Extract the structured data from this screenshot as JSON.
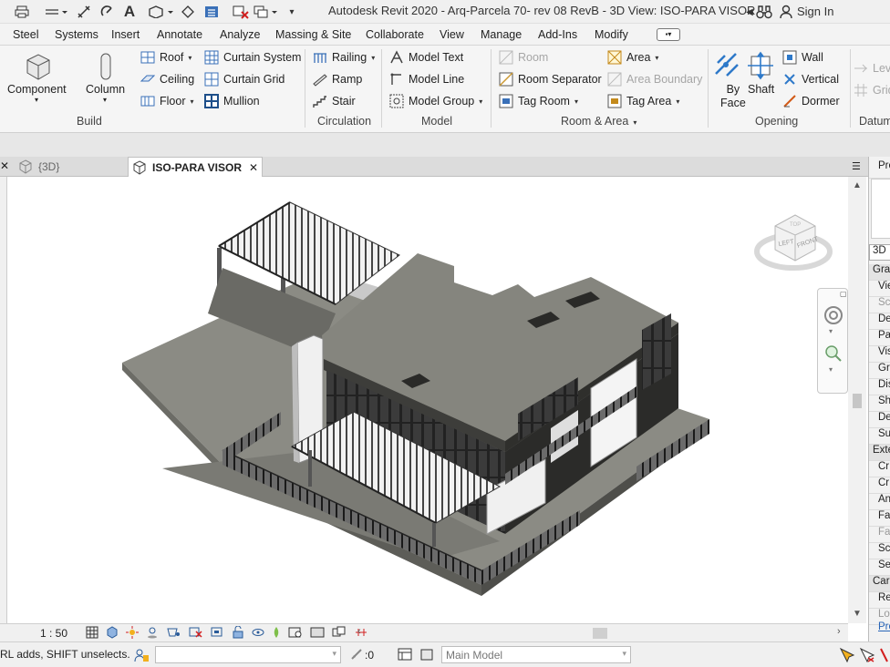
{
  "titlebar": {
    "title": "Autodesk Revit 2020 - Arq-Parcela 70- rev 08 RevB - 3D View: ISO-PARA VISOR",
    "sign_in": "Sign In"
  },
  "menu": {
    "tabs": [
      "Steel",
      "Systems",
      "Insert",
      "Annotate",
      "Analyze",
      "Massing & Site",
      "Collaborate",
      "View",
      "Manage",
      "Add-Ins",
      "Modify"
    ]
  },
  "ribbon": {
    "build": {
      "title": "Build",
      "component": "Component",
      "column": "Column",
      "roof": "Roof",
      "ceiling": "Ceiling",
      "floor": "Floor",
      "curtain_system": "Curtain System",
      "curtain_grid": "Curtain Grid",
      "mullion": "Mullion"
    },
    "circulation": {
      "title": "Circulation",
      "railing": "Railing",
      "ramp": "Ramp",
      "stair": "Stair"
    },
    "model": {
      "title": "Model",
      "model_text": "Model Text",
      "model_line": "Model Line",
      "model_group": "Model Group"
    },
    "room_area": {
      "title": "Room & Area",
      "room": "Room",
      "room_separator": "Room Separator",
      "tag_room": "Tag Room",
      "area": "Area",
      "area_boundary": "Area Boundary",
      "tag_area": "Tag Area"
    },
    "opening": {
      "title": "Opening",
      "by_face_line1": "By",
      "by_face_line2": "Face",
      "shaft": "Shaft",
      "wall": "Wall",
      "vertical": "Vertical",
      "dormer": "Dormer"
    },
    "datum": {
      "title": "Datum",
      "level": "Leve",
      "grid": "Grid"
    }
  },
  "view_tabs": [
    {
      "label": "{3D}",
      "active": false
    },
    {
      "label": "ISO-PARA VISOR",
      "active": true
    }
  ],
  "viewcube": {
    "left_face": "LEFT",
    "front_face": "FRONT",
    "top_face": "TOP"
  },
  "properties": {
    "header": "Pro",
    "type": "3D",
    "rows": [
      "Gra",
      "Vie",
      "Sc",
      "De",
      "Pa",
      "Vis",
      "Gra",
      "Dis",
      "Sh",
      "De",
      "Su",
      "Exte",
      "Cr",
      "Cr",
      "An",
      "Fa",
      "Fa",
      "Sc",
      "Se",
      "Car",
      "Re",
      "Lo"
    ],
    "link": "Pro"
  },
  "viewbar": {
    "scale": "1 : 50"
  },
  "status": {
    "message": "RL adds, SHIFT unselects.",
    "selection_count": ":0",
    "model": "Main Model"
  }
}
